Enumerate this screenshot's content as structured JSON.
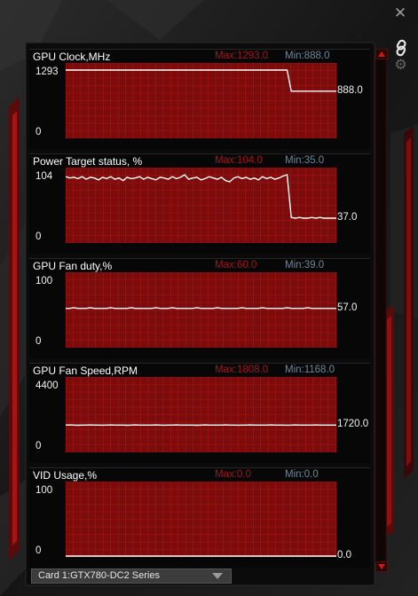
{
  "colors": {
    "plot_fill": "#7a0c0c",
    "grid": "#b71515",
    "trace": "#ffffff",
    "max_text": "#a0161a",
    "min_text": "#6f8798",
    "frame_accent": "#8b1212"
  },
  "window": {
    "close_icon": "close-icon",
    "link_icon": "link-icon",
    "settings_icon": "gear-icon"
  },
  "card_selector": {
    "value": "Card 1:GTX780-DC2 Series"
  },
  "panels": [
    {
      "id": "gpu-clock",
      "title": "GPU Clock,MHz",
      "max_label": "Max:1293.0",
      "min_label": "Min:888.0",
      "axis_top": "1293",
      "axis_bottom": "0",
      "current": "888.0",
      "scale_max": 1293,
      "series": [
        1293,
        1293,
        1293,
        1293,
        1293,
        1293,
        1293,
        1293,
        1293,
        1293,
        1293,
        1293,
        1293,
        1293,
        1293,
        1293,
        1293,
        1293,
        1293,
        1293,
        1293,
        1293,
        1293,
        1293,
        1293,
        1293,
        1293,
        1293,
        1293,
        1293,
        1293,
        1293,
        1293,
        1293,
        1293,
        1293,
        1293,
        1293,
        1293,
        1293,
        1293,
        1293,
        1293,
        1293,
        1293,
        1293,
        1293,
        1293,
        1293,
        1293,
        1293,
        1293,
        1293,
        1293,
        1293,
        888,
        888,
        888,
        888,
        888,
        888,
        888,
        888,
        888,
        888,
        888,
        888
      ]
    },
    {
      "id": "power-target",
      "title": "Power Target status, %",
      "max_label": "Max:104.0",
      "min_label": "Min:35.0",
      "axis_top": "104",
      "axis_bottom": "0",
      "current": "37.0",
      "scale_max": 104,
      "series": [
        101,
        99,
        100,
        98,
        101,
        97,
        100,
        99,
        96,
        100,
        98,
        101,
        97,
        99,
        95,
        100,
        98,
        99,
        101,
        97,
        100,
        98,
        96,
        100,
        99,
        97,
        101,
        98,
        100,
        104,
        97,
        99,
        100,
        96,
        98,
        101,
        99,
        97,
        100,
        95,
        93,
        99,
        101,
        98,
        100,
        97,
        99,
        96,
        101,
        98,
        100,
        97,
        99,
        102,
        104,
        38,
        37,
        38,
        37,
        37,
        38,
        37,
        38,
        37,
        37,
        37,
        37
      ]
    },
    {
      "id": "gpu-fan-duty",
      "title": "GPU Fan duty,%",
      "max_label": "Max:60.0",
      "min_label": "Min:39.0",
      "axis_top": "100",
      "axis_bottom": "0",
      "current": "57.0",
      "scale_max": 100,
      "series": [
        57,
        57,
        58,
        57,
        57,
        57,
        58,
        57,
        57,
        57,
        57,
        58,
        57,
        57,
        57,
        57,
        58,
        57,
        57,
        57,
        57,
        57,
        58,
        57,
        57,
        57,
        58,
        57,
        57,
        57,
        57,
        57,
        58,
        57,
        57,
        57,
        57,
        58,
        57,
        57,
        57,
        57,
        57,
        58,
        57,
        57,
        57,
        57,
        58,
        57,
        57,
        57,
        57,
        57,
        58,
        57,
        57,
        57,
        57,
        58,
        57,
        57,
        57,
        57,
        57,
        57,
        57
      ]
    },
    {
      "id": "gpu-fan-speed",
      "title": "GPU Fan Speed,RPM",
      "max_label": "Max:1808.0",
      "min_label": "Min:1168.0",
      "axis_top": "4400",
      "axis_bottom": "0",
      "current": "1720.0",
      "scale_max": 4400,
      "series": [
        1720,
        1730,
        1720,
        1710,
        1720,
        1720,
        1730,
        1720,
        1720,
        1715,
        1720,
        1730,
        1720,
        1720,
        1720,
        1710,
        1720,
        1730,
        1720,
        1720,
        1720,
        1720,
        1730,
        1720,
        1715,
        1720,
        1720,
        1730,
        1720,
        1720,
        1720,
        1720,
        1710,
        1720,
        1730,
        1720,
        1720,
        1720,
        1720,
        1730,
        1720,
        1720,
        1715,
        1720,
        1720,
        1730,
        1720,
        1720,
        1720,
        1720,
        1730,
        1720,
        1720,
        1720,
        1715,
        1720,
        1730,
        1720,
        1720,
        1720,
        1720,
        1730,
        1720,
        1720,
        1720,
        1720,
        1720
      ]
    },
    {
      "id": "vid-usage",
      "title": "VID Usage,%",
      "max_label": "Max:0.0",
      "min_label": "Min:0.0",
      "axis_top": "100",
      "axis_bottom": "0",
      "current": "0.0",
      "scale_max": 100,
      "series": [
        0,
        0,
        0,
        0,
        0,
        0,
        0,
        0,
        0,
        0,
        0,
        0,
        0,
        0,
        0,
        0,
        0,
        0,
        0,
        0,
        0,
        0,
        0,
        0,
        0,
        0,
        0,
        0,
        0,
        0,
        0,
        0,
        0,
        0,
        0,
        0,
        0,
        0,
        0,
        0,
        0,
        0,
        0,
        0,
        0,
        0,
        0,
        0,
        0,
        0,
        0,
        0,
        0,
        0,
        0,
        0,
        0,
        0,
        0,
        0,
        0,
        0,
        0,
        0,
        0,
        0,
        0
      ]
    }
  ]
}
